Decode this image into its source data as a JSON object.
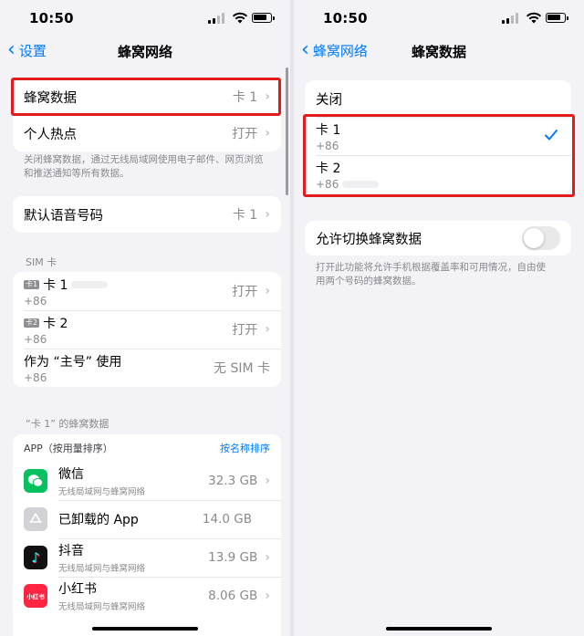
{
  "left": {
    "time": "10:50",
    "back_label": "设置",
    "title": "蜂窝网络",
    "group1": [
      {
        "label": "蜂窝数据",
        "value": "卡 1"
      },
      {
        "label": "个人热点",
        "value": "打开"
      }
    ],
    "group1_footer": "关闭蜂窝数据，通过无线局域网使用电子邮件、网页浏览和推送通知等所有数据。",
    "voice": {
      "label": "默认语音号码",
      "value": "卡 1"
    },
    "sim_header": "SIM 卡",
    "sims": [
      {
        "badge": "卡1",
        "label": "卡 1",
        "number": "+86",
        "value": "打开"
      },
      {
        "badge": "卡2",
        "label": "卡 2",
        "number": "+86",
        "value": "打开"
      },
      {
        "badge": "",
        "label": "作为 “主号” 使用",
        "number": "+86",
        "value": "无 SIM 卡"
      }
    ],
    "usage_header": "“卡 1” 的蜂窝数据",
    "app_list_header": "APP（按用量排序）",
    "sort_link": "按名称排序",
    "apps": [
      {
        "name": "微信",
        "sub": "无线局域网与蜂窝网络",
        "size": "32.3 GB",
        "icon": "wechat-icon",
        "color": "#07c160",
        "glyph": "",
        "chevron": true
      },
      {
        "name": "已卸载的 App",
        "sub": "",
        "size": "14.0 GB",
        "icon": "uninstalled-app-icon",
        "color": "#d1d1d6",
        "glyph": "",
        "chevron": false
      },
      {
        "name": "抖音",
        "sub": "无线局域网与蜂窝网络",
        "size": "13.9 GB",
        "icon": "douyin-icon",
        "color": "#111111",
        "glyph": "♪",
        "chevron": true
      },
      {
        "name": "小红书",
        "sub": "无线局域网与蜂窝网络",
        "size": "8.06 GB",
        "icon": "xiaohongshu-icon",
        "color": "#ff2442",
        "glyph": "小红书",
        "chevron": true
      }
    ]
  },
  "right": {
    "time": "10:50",
    "back_label": "蜂窝网络",
    "title": "蜂窝数据",
    "off_label": "关闭",
    "cards": [
      {
        "label": "卡 1",
        "number": "+86",
        "checked": true
      },
      {
        "label": "卡 2",
        "number": "+86",
        "checked": false
      }
    ],
    "switch_label": "允许切换蜂窝数据",
    "switch_on": false,
    "switch_footer": "打开此功能将允许手机根据覆盖率和可用情况，自由使用两个号码的蜂窝数据。"
  },
  "colors": {
    "accent": "#007aff",
    "highlight": "#e11c1c",
    "background": "#f2f2f7"
  }
}
